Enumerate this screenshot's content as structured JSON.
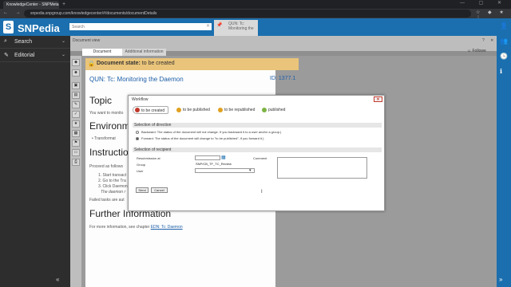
{
  "browser": {
    "tab_title": "KnowledgeCenter - SNPMeta X",
    "new_tab": "+",
    "window_controls": "— ▢ ✕",
    "nav_icons": "← → ⟳",
    "url": "snpedia.snpgroup.com/knowledgecenter/#/documents/documentDetails",
    "ext_icons": "☆ ◆ ★ ⋮"
  },
  "header": {
    "logo_letter": "S",
    "logo_text": "SNPedia",
    "search_placeholder": "Search",
    "search_clear": "✕",
    "open_tab_label": "QUN: Tc: Monitoring the Daemon",
    "open_tab_label_short": "QUN: Tc: Monitoring the"
  },
  "sidebar": {
    "items": [
      {
        "icon": "⌕",
        "label": "Search"
      },
      {
        "icon": "✎",
        "label": "Editorial"
      }
    ],
    "collapse": "«"
  },
  "rightrail": {
    "icons": [
      "👤",
      "👥",
      "🕓",
      "ℹ"
    ],
    "collapse": "»"
  },
  "docview": {
    "title": "Document view",
    "controls": "? ✕",
    "tabs": [
      "Document",
      "Additional information"
    ],
    "follow": "☺ Followe",
    "tool_icons": [
      "◆",
      "☻",
      "▣",
      "▤",
      "✎",
      "✓",
      "★",
      "▦",
      "⚑",
      "▭",
      "⎙"
    ]
  },
  "document": {
    "state_label": "Document state:",
    "state_value": "to be created",
    "title": "QUN: Tc: Monitoring the Daemon",
    "id": "ID: 1377.1",
    "h_topic": "Topic",
    "p_topic": "You want to monito",
    "h_env": "Environme",
    "p_env": "• Transformat",
    "h_instr": "Instruction",
    "p_instr": "Proceed as follows",
    "steps": [
      "1. Start transact",
      "2. Go to the Tra",
      "3. Click Daemon",
      "The daemon r"
    ],
    "p_failed": "Failed tasks are aut",
    "h_further": "Further Information",
    "p_further_prefix": "For more information, see chapter",
    "p_further_link": "EDN: Tc: Daemon"
  },
  "workflow": {
    "title": "Workflow",
    "close": "✕",
    "steps": [
      {
        "label": "to be created",
        "color": "#c0392b"
      },
      {
        "label": "to be published",
        "color": "#e0a020"
      },
      {
        "label": "to be republished",
        "color": "#e0a020"
      },
      {
        "label": "published",
        "color": "#7cb342"
      }
    ],
    "sect_direction": "Selection of direction",
    "backward_label": "Backward: The status of the document will not change. If you backward it to a user and/or a group.)",
    "forward_label": "Forward: The status of the document will change to \"to be published\", if you forward it.)",
    "sect_recipient": "Selection of recipient",
    "resubmission_label": "Resubmission at",
    "group_label": "Group",
    "group_value": "SNP/CB_TF_TC_Review",
    "user_label": "User",
    "user_value": "",
    "comment_label": "Comment",
    "send": "Send",
    "cancel": "Cancel"
  }
}
